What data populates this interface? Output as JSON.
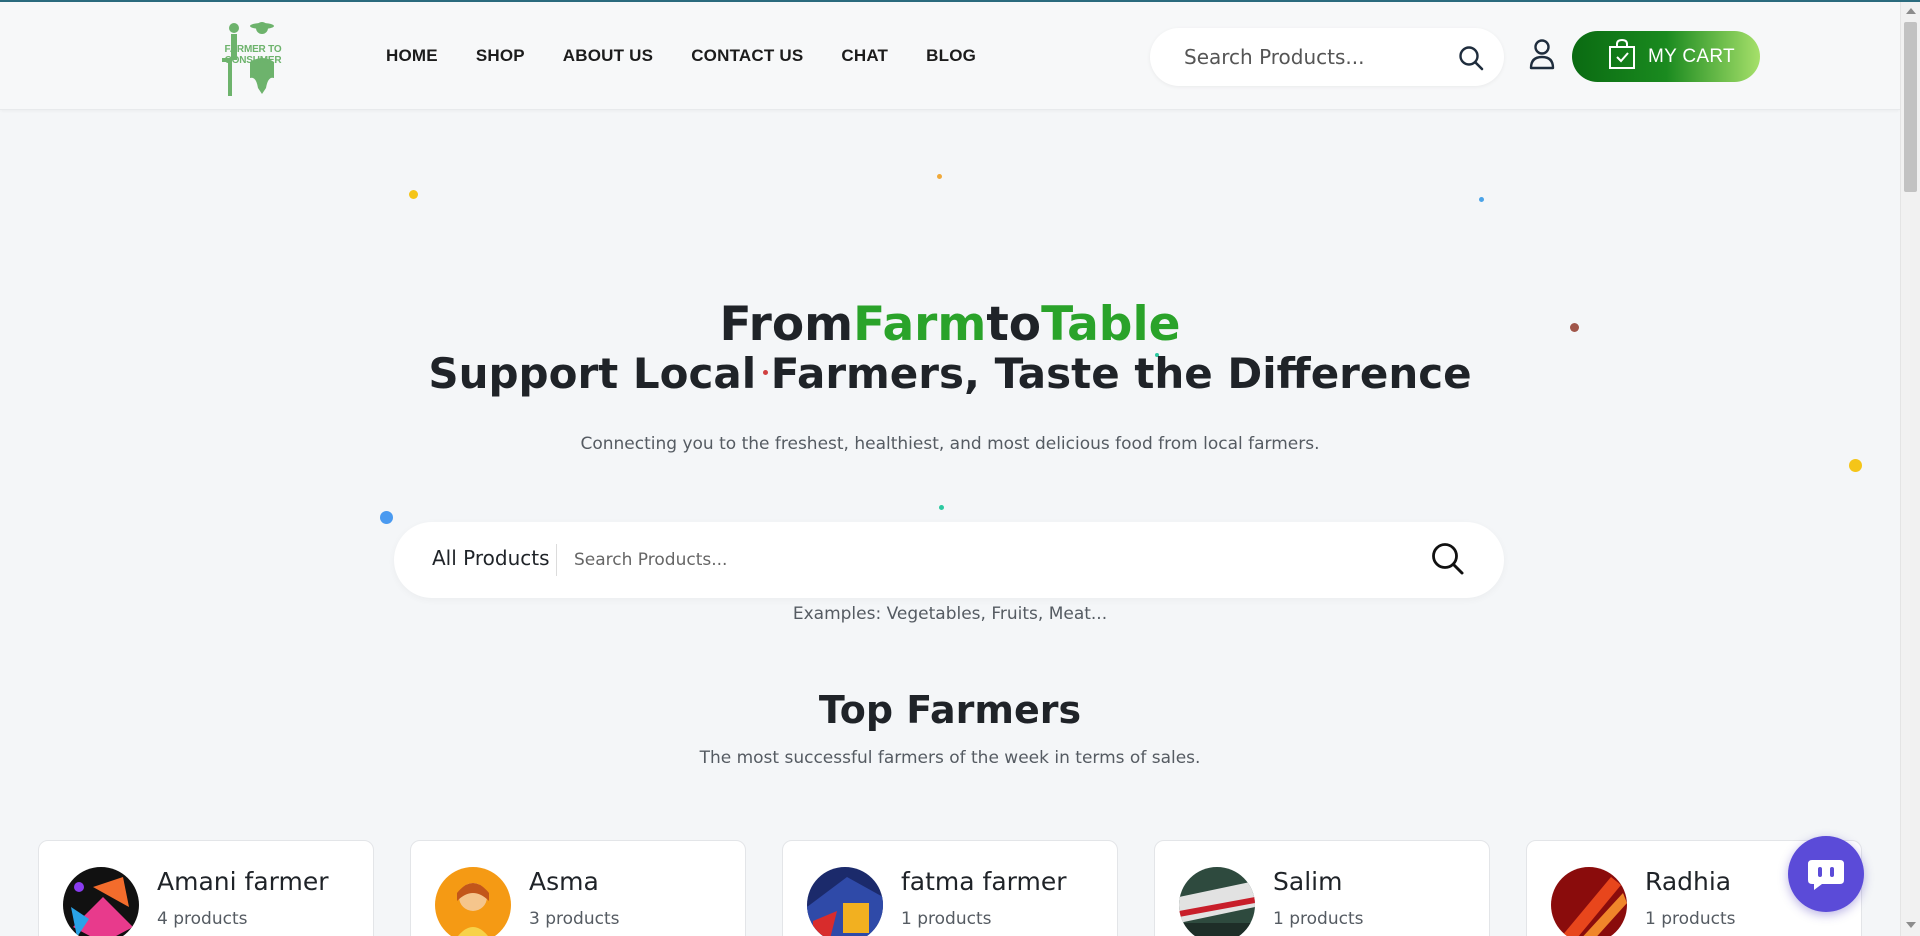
{
  "logo": {
    "text": "FARMER TO CONSUMER",
    "letters": "F T C"
  },
  "nav": {
    "items": [
      {
        "label": "HOME"
      },
      {
        "label": "SHOP"
      },
      {
        "label": "ABOUT US"
      },
      {
        "label": "CONTACT US"
      },
      {
        "label": "CHAT"
      },
      {
        "label": "BLOG"
      }
    ]
  },
  "header_search": {
    "placeholder": "Search Products..."
  },
  "cart": {
    "label": "MY CART"
  },
  "hero": {
    "title_from": "From",
    "title_farm": "Farm",
    "title_to": "to",
    "title_table": "Table",
    "subtitle": "Support Local Farmers, Taste the Difference",
    "description": "Connecting you to the freshest, healthiest, and most delicious food from local farmers."
  },
  "main_search": {
    "category": "All Products",
    "placeholder": "Search Products...",
    "examples": "Examples: Vegetables, Fruits, Meat..."
  },
  "top_farmers": {
    "title": "Top Farmers",
    "subtitle": "The most successful farmers of the week in terms of sales.",
    "farmers": [
      {
        "name": "Amani farmer",
        "products": "4 products"
      },
      {
        "name": "Asma",
        "products": "3 products"
      },
      {
        "name": "fatma farmer",
        "products": "1 products"
      },
      {
        "name": "Salim",
        "products": "1 products"
      },
      {
        "name": "Radhia",
        "products": "1 products"
      }
    ]
  },
  "colors": {
    "brand_green": "#2aa32a",
    "cart_gradient_start": "#0a6b12",
    "cart_gradient_end": "#a6e06a",
    "chat_purple": "#5b4bd8"
  }
}
